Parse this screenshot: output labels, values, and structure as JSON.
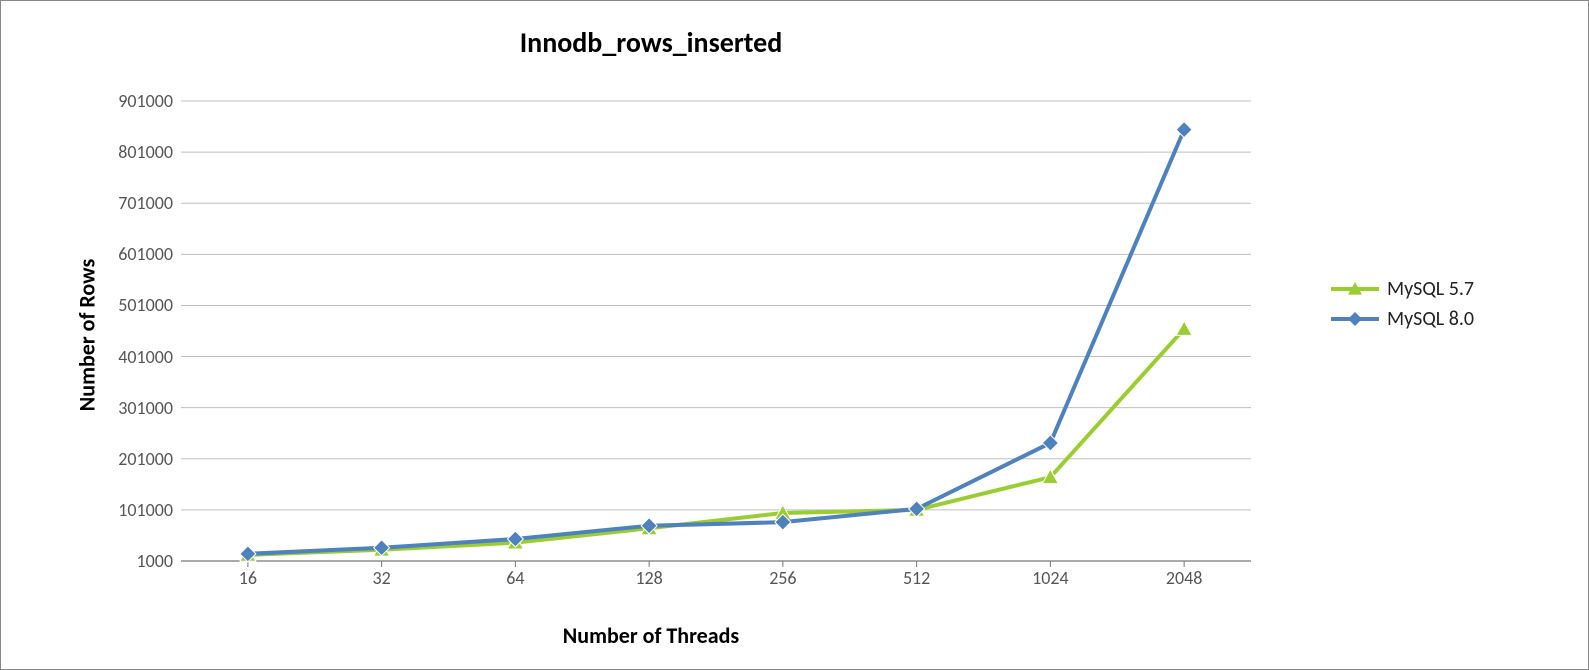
{
  "chart_data": {
    "type": "line",
    "title": "Innodb_rows_inserted",
    "xlabel": "Number of Threads",
    "ylabel": "Number of Rows",
    "categories": [
      "16",
      "32",
      "64",
      "128",
      "256",
      "512",
      "1024",
      "2048"
    ],
    "yticks": [
      "1000",
      "101000",
      "201000",
      "301000",
      "401000",
      "501000",
      "601000",
      "701000",
      "801000",
      "901000"
    ],
    "ylim": [
      1000,
      901000
    ],
    "series": [
      {
        "name": "MySQL 5.7",
        "color": "#9ACD32",
        "marker": "triangle",
        "values": [
          13000,
          23000,
          37000,
          65000,
          95000,
          101000,
          165000,
          455000
        ]
      },
      {
        "name": "MySQL 8.0",
        "color": "#4F81BD",
        "marker": "diamond",
        "values": [
          15000,
          27000,
          44000,
          70000,
          77000,
          103000,
          232000,
          845000
        ]
      }
    ],
    "gridlines": true,
    "legend_position": "right"
  }
}
